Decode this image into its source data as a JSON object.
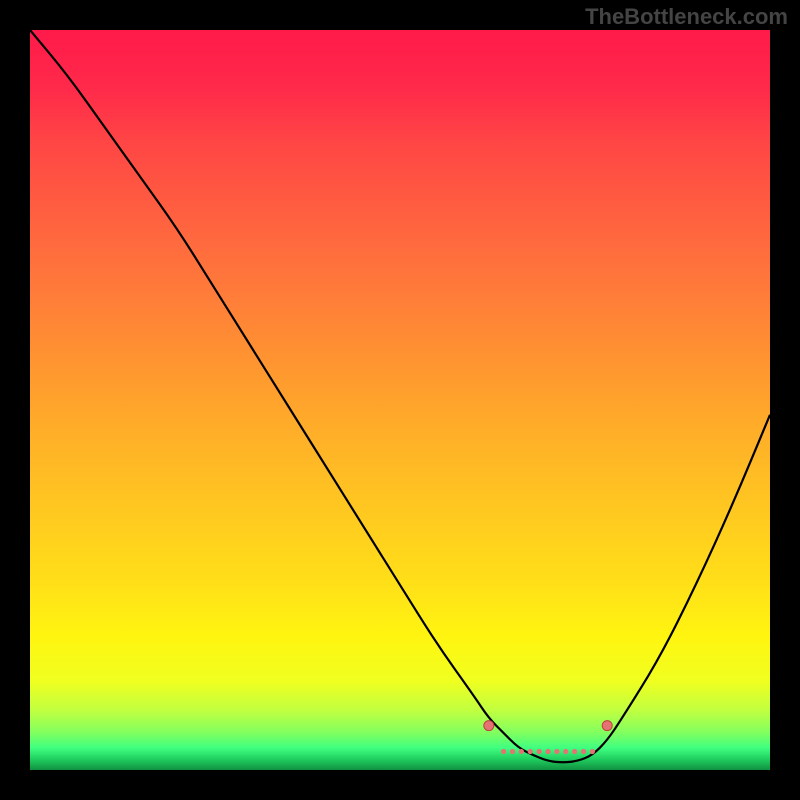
{
  "watermark": "TheBottleneck.com",
  "chart_data": {
    "type": "line",
    "title": "",
    "xlabel": "",
    "ylabel": "",
    "xlim": [
      0,
      100
    ],
    "ylim": [
      0,
      100
    ],
    "series": [
      {
        "name": "curve",
        "x": [
          0,
          5,
          10,
          15,
          20,
          25,
          30,
          35,
          40,
          45,
          50,
          55,
          60,
          62,
          64,
          66,
          68,
          70,
          72,
          74,
          76,
          78,
          80,
          85,
          90,
          95,
          100
        ],
        "values": [
          100,
          94,
          87,
          80,
          73,
          65,
          57,
          49,
          41,
          33,
          25,
          17,
          10,
          7,
          5,
          3,
          2,
          1.2,
          1,
          1.2,
          2,
          4,
          7,
          15,
          25,
          36,
          48
        ]
      }
    ],
    "markers": [
      {
        "name": "band-left",
        "x": 62,
        "y": 6
      },
      {
        "name": "band-right",
        "x": 78,
        "y": 6
      }
    ],
    "dotted_band": {
      "x_start": 64,
      "x_end": 76,
      "y": 2.5
    },
    "gradient_stops": [
      {
        "pos": 0,
        "color": "#ff1a4a"
      },
      {
        "pos": 0.25,
        "color": "#ff6040"
      },
      {
        "pos": 0.55,
        "color": "#ffb028"
      },
      {
        "pos": 0.82,
        "color": "#fff510"
      },
      {
        "pos": 0.95,
        "color": "#80ff60"
      },
      {
        "pos": 1.0,
        "color": "#109040"
      }
    ]
  }
}
